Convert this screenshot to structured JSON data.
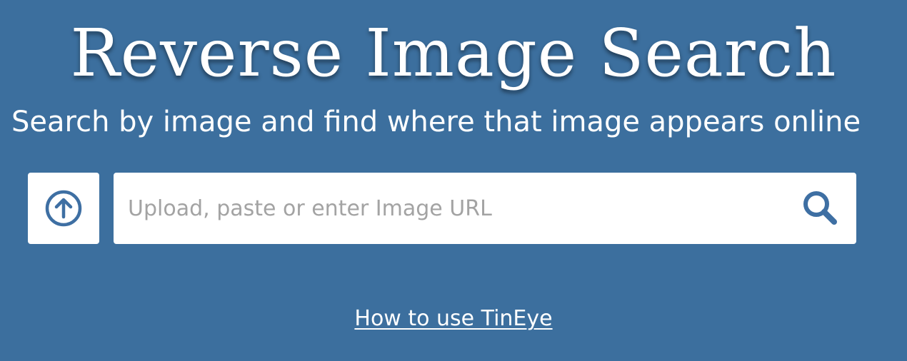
{
  "colors": {
    "background": "#3c6f9e",
    "accent": "#3e6fa3",
    "text": "#ffffff",
    "placeholder": "#a3a3a3"
  },
  "header": {
    "title": "Reverse Image Search",
    "subtitle": "Search by image and find where that image appears online"
  },
  "upload": {
    "icon": "upload-arrow-circle-icon"
  },
  "search": {
    "placeholder": "Upload, paste or enter Image URL",
    "value": "",
    "icon": "search-icon"
  },
  "help": {
    "link_label": "How to use TinEye"
  }
}
